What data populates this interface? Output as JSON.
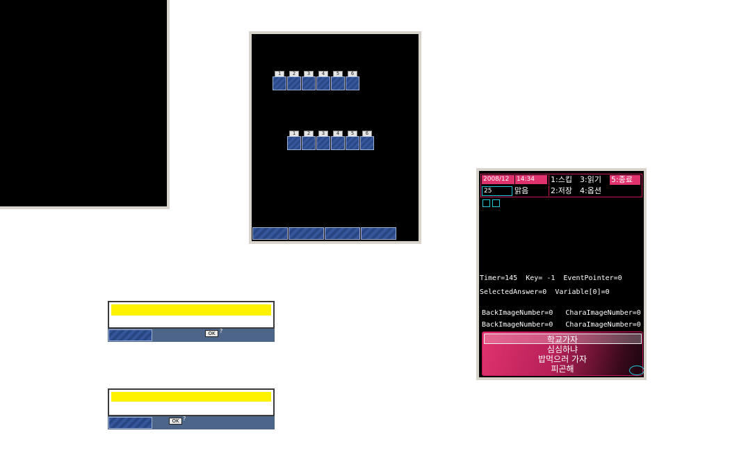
{
  "left_panel": {},
  "slot_window": {
    "row1_labels": [
      "1",
      "2",
      "3",
      "4",
      "5",
      "6"
    ],
    "row2_labels": [
      "1",
      "2",
      "3",
      "4",
      "5",
      "6"
    ],
    "bottom_buttons": 4
  },
  "dialog1": {
    "ok_label": "OK",
    "help_glyph": "?"
  },
  "dialog2": {
    "ok_label": "OK",
    "help_glyph": "?"
  },
  "phone": {
    "date": "2008/12",
    "time": "14:34",
    "day": "25",
    "weather": "맑음",
    "menu": {
      "skip": "1:스킵",
      "save": "2:저장",
      "load": "3:읽기",
      "options": "4:옵션",
      "quit": "5:종료"
    },
    "debug": {
      "line1": "Timer=145  Key= -1  EventPointer=0",
      "line2": "SelectedAnswer=0  Variable[0]=0",
      "line3": "BackImageNumber=0   CharaImageNumber=0",
      "line4": "BackImageNumber=0   CharaImageNumber=0"
    },
    "choices": [
      "학교가자",
      "심심하냐",
      "밥먹으러 가자",
      "피곤해"
    ]
  },
  "colors": {
    "hud_pink": "#e0336e",
    "hud_border": "#c2185b",
    "dialog_yellow": "#fff200",
    "dialog_bar": "#4d6589",
    "slot_blue": "#35569a",
    "cyan": "#20c8d8"
  }
}
